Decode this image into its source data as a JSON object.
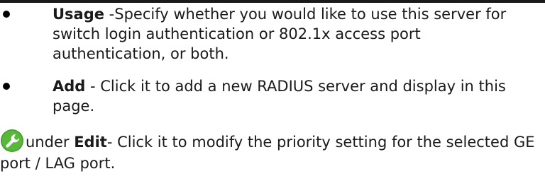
{
  "items": [
    {
      "term": "Usage",
      "text": " -Specify whether you would like to use this server for switch login authentication or 802.1x access port authentication, or both."
    },
    {
      "term": "Add",
      "text": " - Click it to add a new RADIUS server and display in this page."
    }
  ],
  "edit": {
    "icon": "wrench-icon",
    "prefix": "under ",
    "term": "Edit",
    "text": "- Click it to modify the priority setting for the selected GE port / LAG port."
  }
}
